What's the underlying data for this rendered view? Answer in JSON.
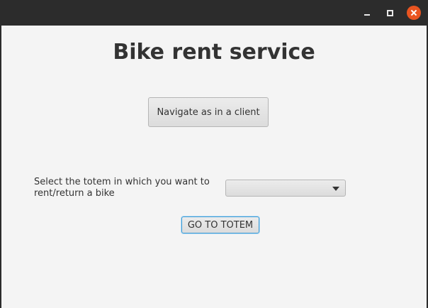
{
  "window": {
    "controls": {
      "minimize_icon": "minimize-icon",
      "maximize_icon": "maximize-icon",
      "close_icon": "close-icon",
      "close_color": "#e95420"
    }
  },
  "main": {
    "title": "Bike rent service",
    "navigate_button_label": "Navigate as in a client",
    "totem_select_label": "Select the totem in which you want to rent/return a bike",
    "totem_select_value": "",
    "go_button_label": "GO TO TOTEM"
  }
}
